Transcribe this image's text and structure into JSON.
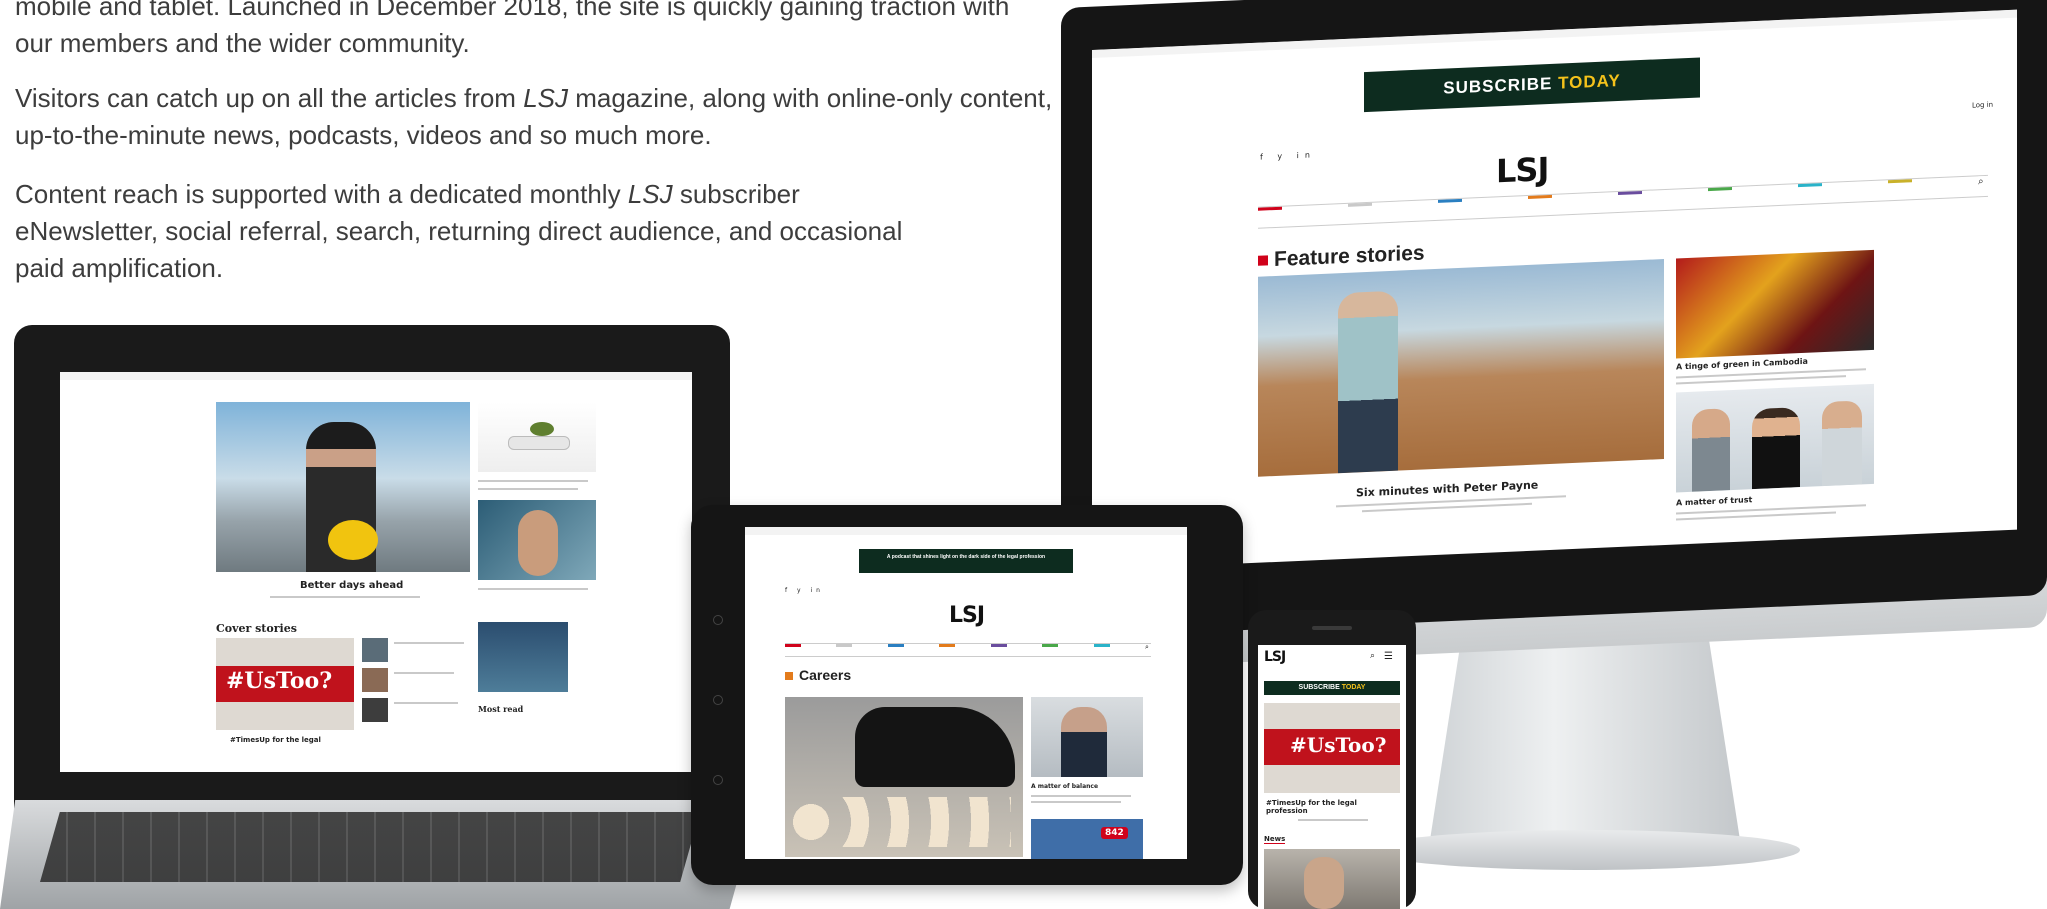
{
  "intro": {
    "p0": "mobile and tablet. Launched in December 2018, the site is quickly gaining traction with our members and the wider community.",
    "p1_a": "Visitors can catch up on all the articles from ",
    "p1_em": "LSJ",
    "p1_b": " magazine, along with online-only content, up-to-the-minute news, podcasts, videos and so much more.",
    "p2_a": "Content reach is supported with a dedicated monthly ",
    "p2_em": "LSJ",
    "p2_b": " subscriber eNewsletter, social referral, search, returning direct audience, and occasional paid amplification."
  },
  "desktop": {
    "banner_a": "SUBSCRIBE ",
    "banner_b": "TODAY",
    "logo": "LSJ",
    "section": "Feature stories",
    "lead_caption": "Six minutes with Peter Payne",
    "side1_caption": "A tinge of green in Cambodia",
    "side2_caption": "A matter of trust",
    "login": "Log in"
  },
  "laptop": {
    "hero_caption": "Better days ahead",
    "cover_heading": "Cover stories",
    "cover_tag": "#UsToo?",
    "cover_caption": "#TimesUp for the legal",
    "side_heading": "Most read"
  },
  "tablet": {
    "banner": "A podcast that shines light on the dark side of the legal profession",
    "logo": "LSJ",
    "section": "Careers",
    "badge": "842",
    "side_caption": "A matter of balance"
  },
  "phone": {
    "logo": "LSJ",
    "banner_a": "SUBSCRIBE ",
    "banner_b": "TODAY",
    "tag": "#UsToo?",
    "caption": "#TimesUp for the legal profession",
    "section": "News"
  },
  "colors": {
    "accent_red": "#d0021b",
    "banner_green": "#0d2c1f",
    "banner_yellow": "#f4c21b"
  }
}
